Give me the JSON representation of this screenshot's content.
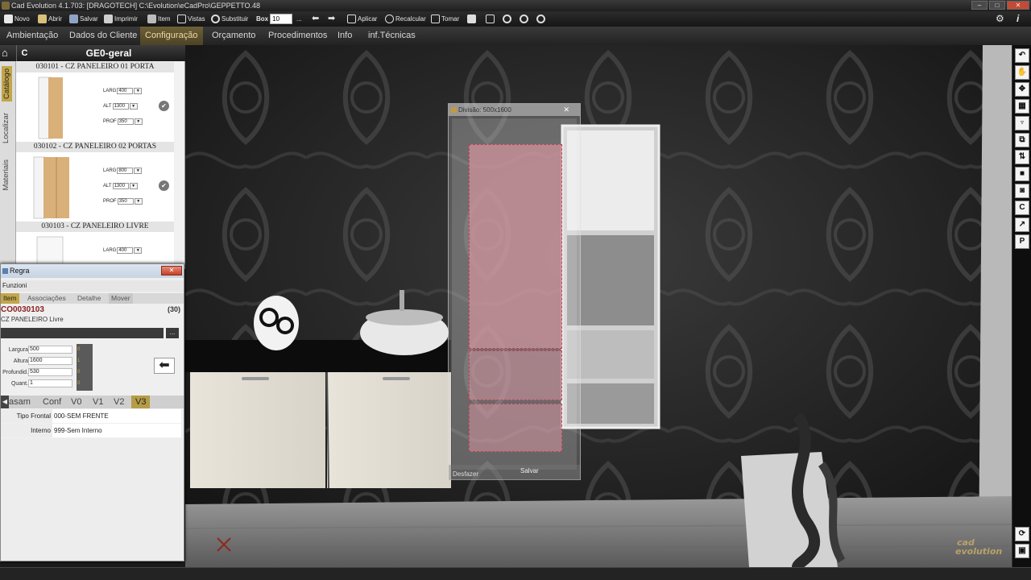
{
  "window": {
    "title": "Cad Evolution 4.1.703: [DRAGOTECH]  C:\\Evolution\\eCadPro\\GEPPETTO.48",
    "controls": [
      "–",
      "□",
      "✕"
    ]
  },
  "toolbar": {
    "novo": "Novo",
    "abrir": "Abrir",
    "salvar": "Salvar",
    "imprimir": "Imprimir",
    "item": "Item",
    "vistas": "Vistas",
    "substituir": "Substituir",
    "box_label": "Box",
    "box_value": "10",
    "dots": "...",
    "aplicar": "Aplicar",
    "recalcular": "Recalcular",
    "tomar": "Tomar",
    "right_settings": "⚙",
    "right_info": "i"
  },
  "menu": {
    "items": [
      "Ambientação",
      "Dados do Cliente",
      "Configuração",
      "Orçamento",
      "Procedimentos",
      "Info",
      "inf.Técnicas"
    ],
    "active_index": 2
  },
  "left_panel": {
    "home_glyph": "⌂",
    "c_label": "C",
    "title": "GE0-geral",
    "vertical_tabs": [
      "Catálogo",
      "Localizar",
      "Materiais"
    ],
    "catalog": [
      {
        "title": "030101 - CZ PANELEIRO 01 PORTA",
        "dims": [
          {
            "label": "LARG",
            "value": "400"
          },
          {
            "label": "ALT",
            "value": "1300"
          },
          {
            "label": "PROF",
            "value": "350"
          }
        ]
      },
      {
        "title": "030102 - CZ PANELEIRO 02 PORTAS",
        "dims": [
          {
            "label": "LARG",
            "value": "800"
          },
          {
            "label": "ALT",
            "value": "1300"
          },
          {
            "label": "PROF",
            "value": "350"
          }
        ]
      },
      {
        "title": "030103 - CZ PANELEIRO LIVRE",
        "dims": [
          {
            "label": "LARG",
            "value": "400"
          }
        ]
      }
    ]
  },
  "regra": {
    "title": "Regra",
    "close": "✕",
    "funzioni": "Funzioni",
    "tabs": [
      "Item",
      "Associações",
      "Detalhe",
      "Mover"
    ],
    "active_tab": 0,
    "code": "CO0030103",
    "count": "(30)",
    "description": "CZ PANELEIRO Livre",
    "browse": "...",
    "fields": [
      {
        "label": "Largura",
        "value": "500"
      },
      {
        "label": "Altura",
        "value": "1600"
      },
      {
        "label": "Profundid.",
        "value": "530"
      },
      {
        "label": "Quant.",
        "value": "1"
      }
    ],
    "field_flags": [
      "0",
      "1",
      "0",
      "0"
    ],
    "arrow": "⬅",
    "left_arrow": "◀",
    "variant_tabs": [
      "asam",
      "Conf",
      "V0",
      "V1",
      "V2",
      "V3"
    ],
    "variant_active": 5,
    "properties": [
      {
        "key": "Tipo Frontal",
        "value": "000-SEM FRENTE"
      },
      {
        "key": "Interno",
        "value": "999-Sem Interno"
      }
    ]
  },
  "divisao": {
    "title": "Divisão: 500x1600",
    "close": "✕",
    "undo": "Desfazer",
    "save": "Salvar"
  },
  "right_tools": [
    "↶",
    "✋",
    "✥",
    "▦",
    "♆",
    "⧉",
    "⇅",
    "■",
    "◙",
    "C",
    "↗",
    "P"
  ],
  "right_bottom_tools": [
    "⟳",
    "▣"
  ],
  "logo": {
    "text_a": "cad",
    "text_b": "evolution"
  }
}
